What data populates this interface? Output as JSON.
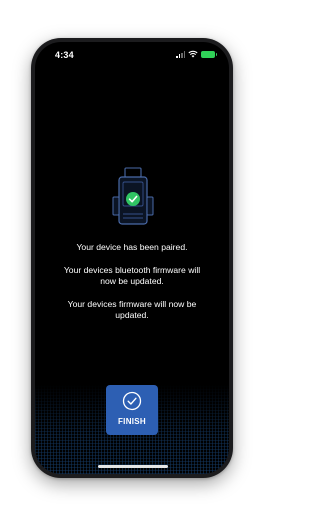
{
  "status_bar": {
    "time": "4:34",
    "icons": [
      "signal-icon",
      "wifi-icon",
      "battery-charging-icon"
    ]
  },
  "pairing": {
    "device_icon": "obd-device-icon",
    "check_icon": "check-badge-icon",
    "messages": [
      "Your device has been paired.",
      "Your devices bluetooth firmware will now be updated.",
      "Your devices firmware will now be updated."
    ]
  },
  "finish_button": {
    "label": "FINISH",
    "icon": "check-circle-icon"
  },
  "colors": {
    "background": "#000000",
    "button": "#2d5fb3",
    "success_green": "#30c463",
    "device_outline": "#4a6aa8",
    "battery": "#30d158"
  }
}
